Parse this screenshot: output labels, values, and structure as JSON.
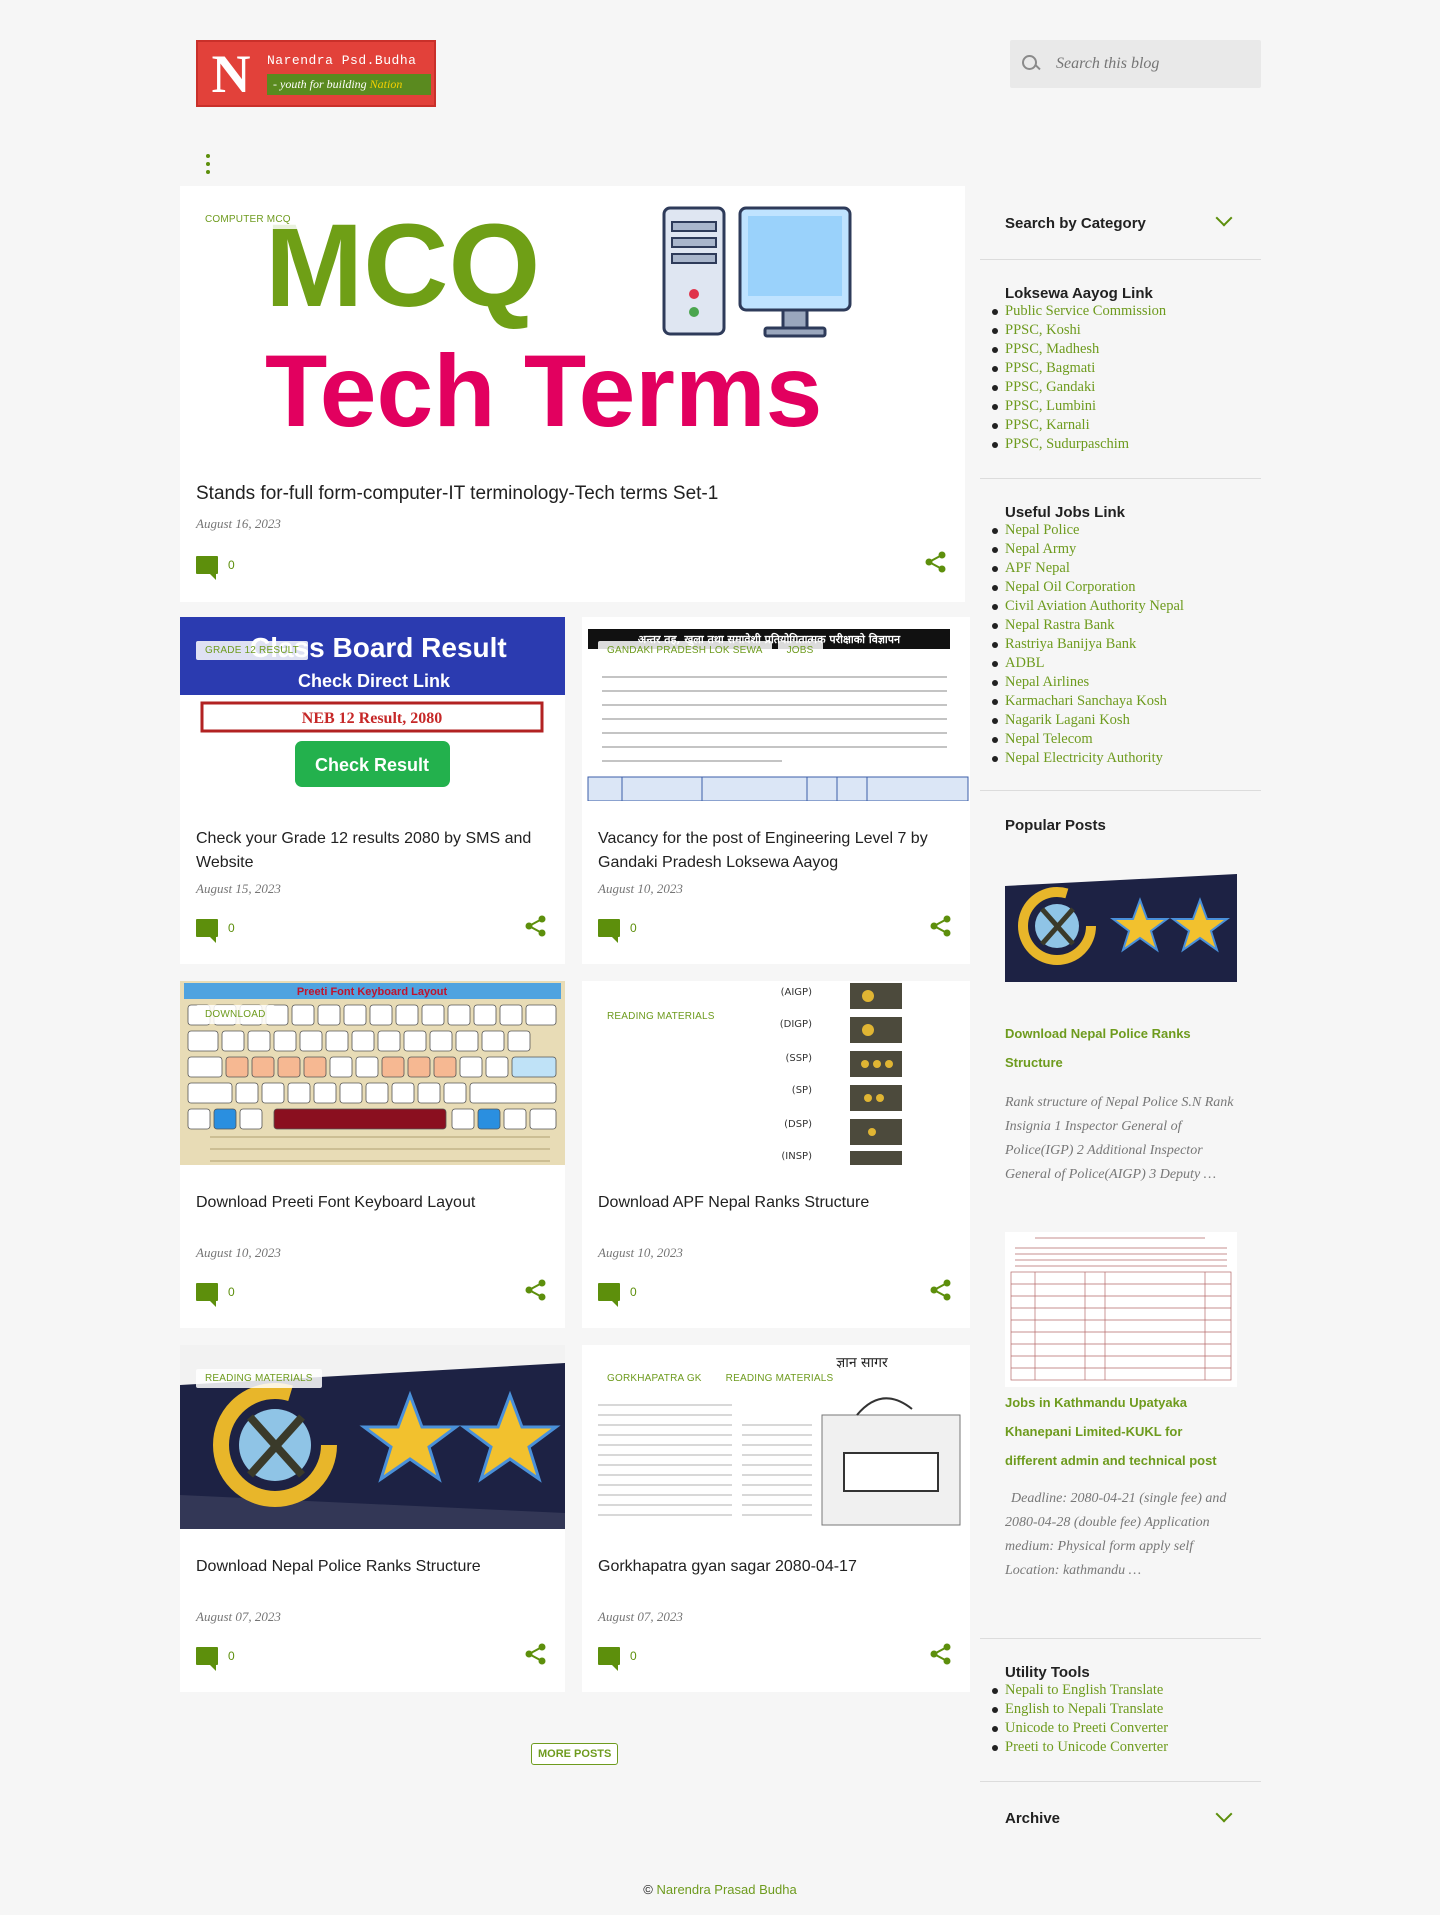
{
  "header": {
    "logo_letter": "N",
    "logo_name": "Narendra Psd.Budha",
    "logo_tagline_prefix": "- youth for building",
    "logo_tagline_accent": "Nation",
    "search_placeholder": "Search this blog"
  },
  "featured": {
    "label": "COMPUTER MCQ",
    "image_text_line1": "MCQ",
    "image_text_line2": "Tech Terms",
    "title": "Stands for-full form-computer-IT terminology-Tech terms Set-1",
    "date": "August 16, 2023",
    "comments": "0"
  },
  "posts": [
    {
      "labels": [
        "GRADE 12 RESULT"
      ],
      "image_heading": "Class Board Result",
      "image_sub": "Check Direct Link",
      "image_box": "NEB 12 Result, 2080",
      "image_button": "Check Result",
      "title": "Check your Grade 12 results 2080 by SMS and Website",
      "date": "August 15, 2023",
      "comments": "0"
    },
    {
      "labels": [
        "GANDAKI PRADESH LOK SEWA",
        "JOBS"
      ],
      "image_heading": "अन्तर तह, खुला तथा समावेशी प्रतियोगितात्मक परीक्षाको विज्ञापन",
      "title": "Vacancy for the post of Engineering Level 7 by Gandaki Pradesh Loksewa Aayog",
      "date": "August 10, 2023",
      "comments": "0"
    },
    {
      "labels": [
        "DOWNLOAD"
      ],
      "image_heading": "Preeti Font Keyboard Layout",
      "title": "Download Preeti Font Keyboard Layout",
      "date": "August 10, 2023",
      "comments": "0"
    },
    {
      "labels": [
        "READING MATERIALS"
      ],
      "image_ranks": [
        "AIGP",
        "DIGP",
        "SSP",
        "SP",
        "DSP",
        "INSP"
      ],
      "title": "Download APF Nepal Ranks Structure",
      "date": "August 10, 2023",
      "comments": "0"
    },
    {
      "labels": [
        "READING MATERIALS"
      ],
      "title": "Download Nepal Police Ranks Structure",
      "date": "August 07, 2023",
      "comments": "0"
    },
    {
      "labels": [
        "GORKHAPATRA GK",
        "READING MATERIALS"
      ],
      "image_heading": "ज्ञान सागर",
      "title": "Gorkhapatra gyan sagar 2080-04-17",
      "date": "August 07, 2023",
      "comments": "0"
    }
  ],
  "more_posts": "MORE POSTS",
  "sidebar": {
    "search_by_category": "Search by Category",
    "loksewa_heading": "Loksewa Aayog Link",
    "loksewa_links": [
      "Public Service Commission",
      "PPSC, Koshi",
      "PPSC, Madhesh",
      "PPSC, Bagmati",
      "PPSC, Gandaki",
      "PPSC, Lumbini",
      "PPSC, Karnali",
      "PPSC, Sudurpaschim"
    ],
    "jobs_heading": "Useful Jobs Link",
    "jobs_links": [
      "Nepal Police",
      "Nepal Army",
      "APF Nepal",
      "Nepal Oil Corporation",
      "Civil Aviation Authority Nepal",
      "Nepal Rastra Bank",
      "Rastriya Banijya Bank",
      "ADBL",
      "Nepal Airlines",
      "Karmachari Sanchaya Kosh",
      "Nagarik Lagani Kosh",
      "Nepal Telecom",
      "Nepal Electricity Authority"
    ],
    "popular_heading": "Popular Posts",
    "popular": [
      {
        "title": "Download Nepal Police Ranks Structure",
        "snippet": "Rank structure of Nepal Police S.N Rank Insignia 1 Inspector General of Police(IGP) 2 Additional Inspector General of Police(AIGP) 3 Deputy …"
      },
      {
        "title": "Jobs in Kathmandu Upatyaka Khanepani Limited-KUKL for different admin and technical post",
        "snippet": "Deadline: 2080-04-21 (single fee) and 2080-04-28 (double fee) Application medium: Physical form apply self  Location: kathmandu …"
      }
    ],
    "utility_heading": "Utility Tools",
    "utility_links": [
      "Nepali to English Translate",
      "English to Nepali Translate",
      "Unicode to Preeti Converter",
      "Preeti to Unicode Converter"
    ],
    "archive": "Archive"
  },
  "footer": {
    "copyright": "©",
    "author": "Narendra Prasad Budha"
  },
  "colors": {
    "accent": "#6e9b1e",
    "background": "#f6f6f6",
    "card": "#ffffff"
  }
}
